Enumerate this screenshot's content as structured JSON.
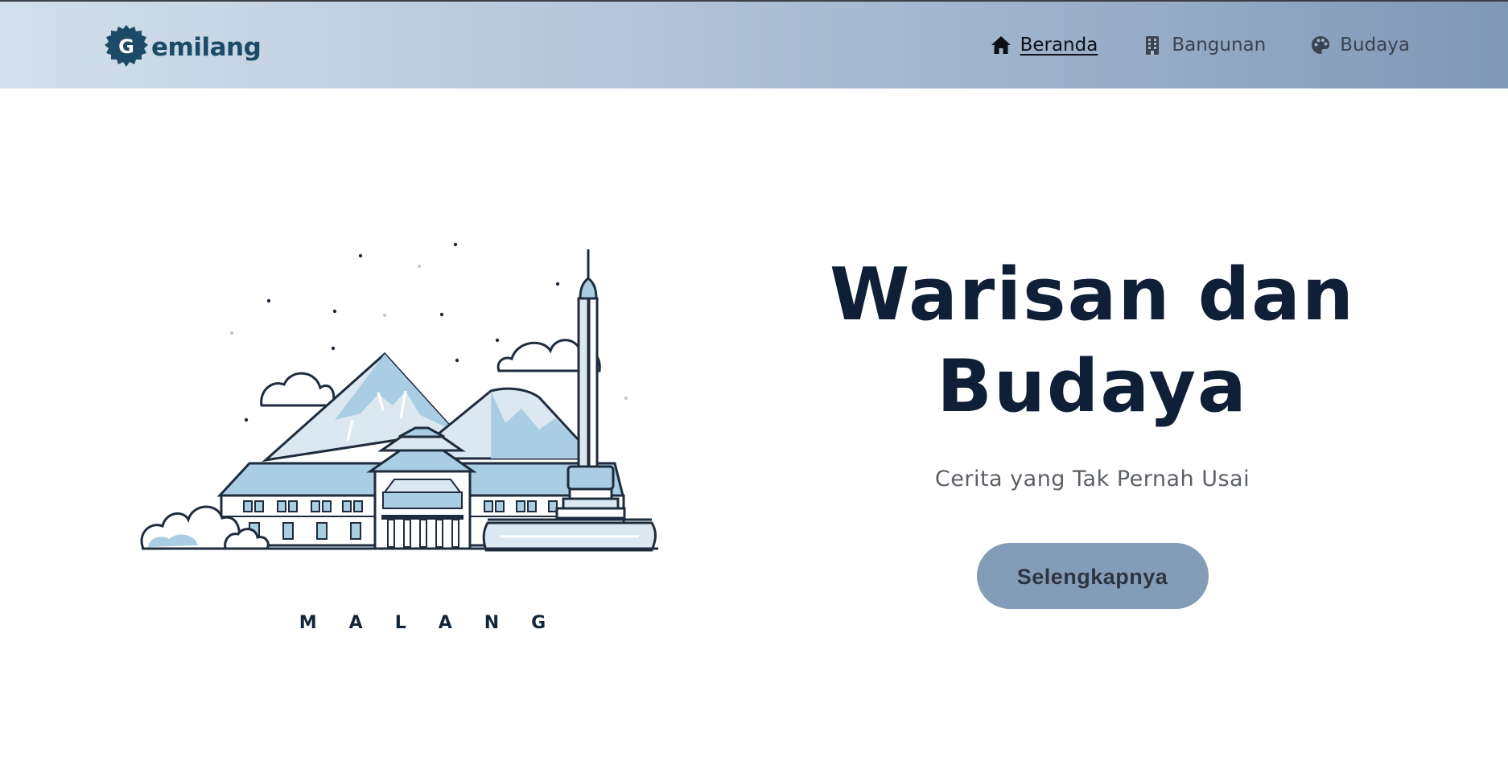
{
  "header": {
    "logo_letter": "G",
    "logo_text": "emilang",
    "nav": [
      {
        "label": "Beranda",
        "icon": "home-icon",
        "active": true
      },
      {
        "label": "Bangunan",
        "icon": "building-icon",
        "active": false
      },
      {
        "label": "Budaya",
        "icon": "palette-icon",
        "active": false
      }
    ]
  },
  "hero": {
    "title_line1": "Warisan dan",
    "title_line2": "Budaya",
    "subtitle": "Cerita yang Tak Pernah Usai",
    "cta_label": "Selengkapnya",
    "illustration_caption": "MALANG"
  },
  "colors": {
    "logo": "#1b4b66",
    "title": "#0f1f38",
    "button": "#839cb8",
    "nav_gradient_start": "#d3dfeb",
    "nav_gradient_end": "#7f98b6"
  }
}
